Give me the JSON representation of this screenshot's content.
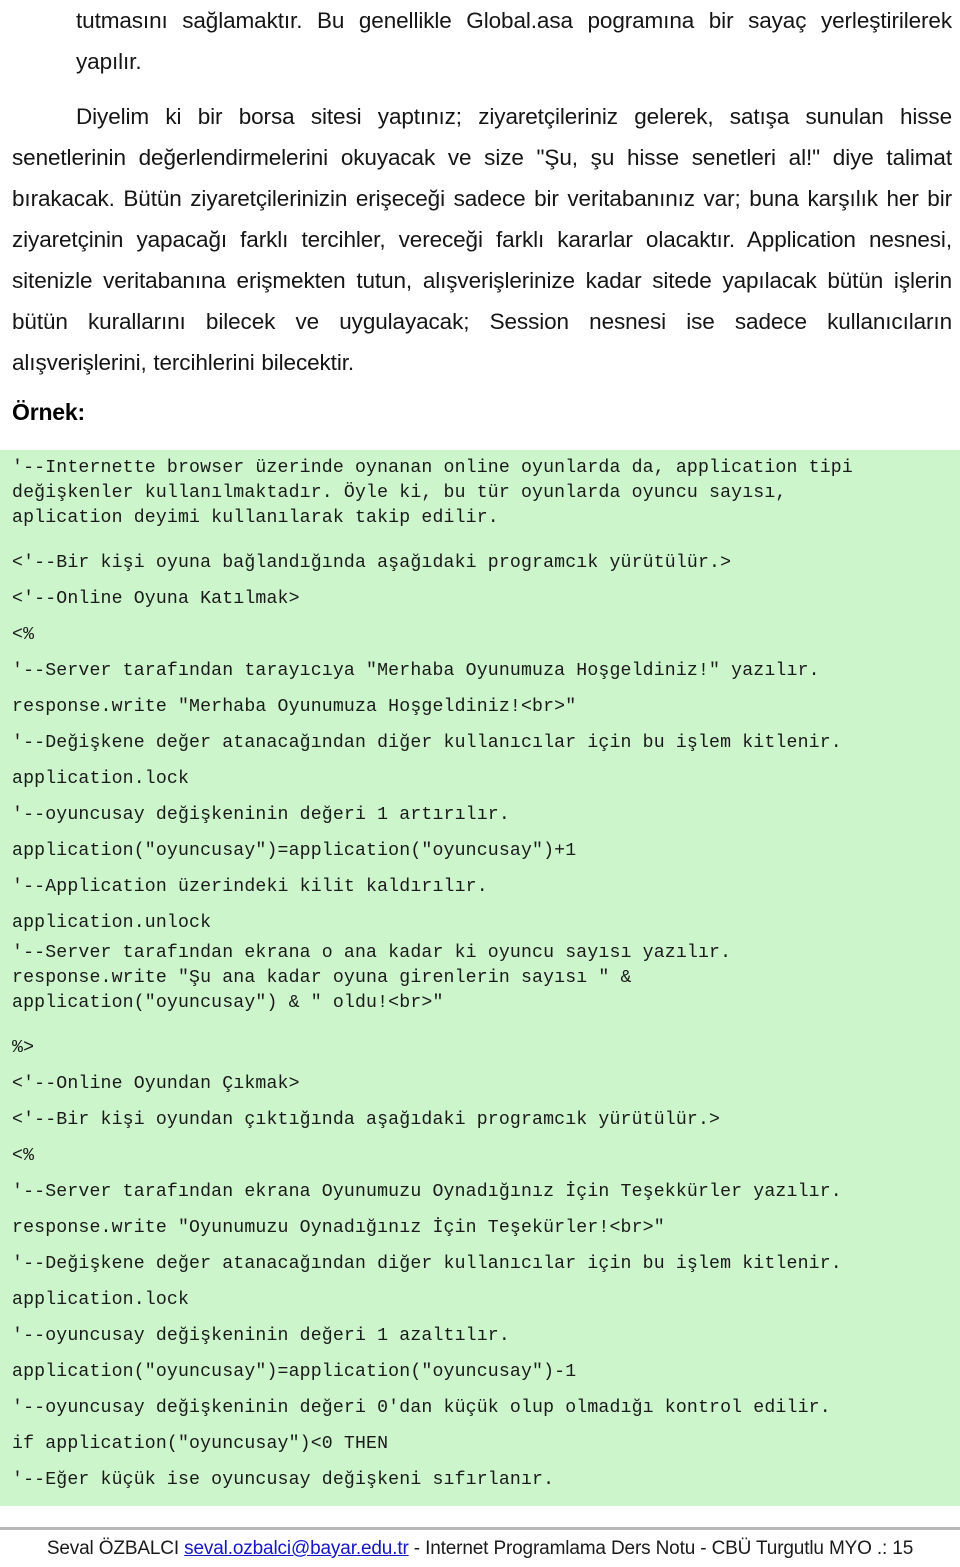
{
  "document": {
    "language": "tr",
    "page_number": "15",
    "body": {
      "paragraph_1": "tutmasını sağlamaktır. Bu genellikle Global.asa pogramına bir sayaç yerleştirilerek yapılır.",
      "paragraph_2": "Diyelim ki bir borsa sitesi yaptınız; ziyaretçileriniz gelerek, satışa sunulan hisse senetlerinin değerlendirmelerini okuyacak ve size \"Şu, şu hisse senetleri al!\" diye talimat bırakacak. Bütün ziyaretçilerinizin erişeceği sadece bir veritabanınız var; buna karşılık her bir ziyaretçinin yapacağı farklı tercihler, vereceği farklı kararlar olacaktır. Application nesnesi, sitenizle veritabanına erişmekten tutun, alışverişlerinize kadar sitede yapılacak bütün işlerin bütün kurallarını bilecek ve uygulayacak; Session nesnesi ise sadece kullanıcıların alışverişlerini, tercihlerini bilecektir."
    },
    "heading_ornek": "Örnek:",
    "code": {
      "lines": [
        {
          "text": "'--Internette browser üzerinde oynanan online oyunlarda da, application tipi",
          "spacing": "tight"
        },
        {
          "text": "değişkenler kullanılmaktadır. Öyle ki, bu tür oyunlarda oyuncu sayısı,",
          "spacing": "tight"
        },
        {
          "text": "aplication deyimi kullanılarak takip edilir.",
          "spacing": "tight"
        },
        {
          "text": "",
          "spacing": "blank"
        },
        {
          "text": "<'--Bir kişi oyuna bağlandığında aşağıdaki programcık yürütülür.>",
          "spacing": "normal"
        },
        {
          "text": "<'--Online Oyuna Katılmak>",
          "spacing": "normal"
        },
        {
          "text": "<%",
          "spacing": "normal"
        },
        {
          "text": "'--Server tarafından tarayıcıya \"Merhaba Oyunumuza Hoşgeldiniz!\" yazılır.",
          "spacing": "normal"
        },
        {
          "text": "response.write \"Merhaba Oyunumuza Hoşgeldiniz!<br>\"",
          "spacing": "normal"
        },
        {
          "text": "'--Değişkene değer atanacağından diğer kullanıcılar için bu işlem kitlenir.",
          "spacing": "normal"
        },
        {
          "text": "application.lock",
          "spacing": "normal"
        },
        {
          "text": "'--oyuncusay değişkeninin değeri 1 artırılır.",
          "spacing": "normal"
        },
        {
          "text": "application(\"oyuncusay\")=application(\"oyuncusay\")+1",
          "spacing": "normal"
        },
        {
          "text": "'--Application üzerindeki kilit kaldırılır.",
          "spacing": "normal"
        },
        {
          "text": "application.unlock",
          "spacing": "normal"
        },
        {
          "text": "'--Server tarafından ekrana o ana kadar ki oyuncu sayısı yazılır.",
          "spacing": "tight"
        },
        {
          "text": "response.write \"Şu ana kadar oyuna girenlerin sayısı \" &",
          "spacing": "tight"
        },
        {
          "text": "application(\"oyuncusay\") & \" oldu!<br>\"",
          "spacing": "tight"
        },
        {
          "text": "",
          "spacing": "blank"
        },
        {
          "text": "%>",
          "spacing": "normal"
        },
        {
          "text": "<'--Online Oyundan Çıkmak>",
          "spacing": "normal"
        },
        {
          "text": "<'--Bir kişi oyundan çıktığında aşağıdaki programcık yürütülür.>",
          "spacing": "normal"
        },
        {
          "text": "<%",
          "spacing": "normal"
        },
        {
          "text": "'--Server tarafından ekrana Oyunumuzu Oynadığınız İçin Teşekkürler yazılır.",
          "spacing": "normal"
        },
        {
          "text": "response.write \"Oyunumuzu Oynadığınız İçin Teşekürler!<br>\"",
          "spacing": "normal"
        },
        {
          "text": "'--Değişkene değer atanacağından diğer kullanıcılar için bu işlem kitlenir.",
          "spacing": "normal"
        },
        {
          "text": "application.lock",
          "spacing": "normal"
        },
        {
          "text": "'--oyuncusay değişkeninin değeri 1 azaltılır.",
          "spacing": "normal"
        },
        {
          "text": "application(\"oyuncusay\")=application(\"oyuncusay\")-1",
          "spacing": "normal"
        },
        {
          "text": "'--oyuncusay değişkeninin değeri 0'dan küçük olup olmadığı kontrol edilir.",
          "spacing": "normal"
        },
        {
          "text": "if application(\"oyuncusay\")<0 THEN",
          "spacing": "normal"
        },
        {
          "text": "'--Eğer küçük ise oyuncusay değişkeni sıfırlanır.",
          "spacing": "normal"
        }
      ]
    },
    "footer": {
      "author": "Seval ÖZBALCI",
      "email": "seval.ozbalci@bayar.edu.tr",
      "separator_1": " - ",
      "course": "Internet Programlama Ders Notu",
      "separator_2": " - ",
      "institution": "CBÜ Turgutlu MYO",
      "page_marker": " .: 15"
    }
  },
  "colors": {
    "code_background": "#ccf5cc",
    "link": "#1515c8",
    "text": "#151515",
    "rule": "#b8b8b8"
  }
}
